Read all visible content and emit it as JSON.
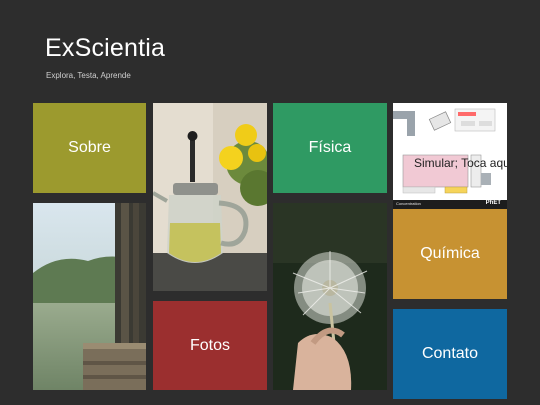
{
  "header": {
    "title": "ExScientia",
    "subtitle": "Explora, Testa, Aprende"
  },
  "tiles": {
    "sobre": {
      "label": "Sobre",
      "color": "#9c9a2e"
    },
    "fisica": {
      "label": "Física",
      "color": "#2f9a63"
    },
    "fotos": {
      "label": "Fotos",
      "color": "#9b2f2f"
    },
    "quimica": {
      "label": "Química",
      "color": "#c79232"
    },
    "contato": {
      "label": "Contato",
      "color": "#0f68a0"
    },
    "simular": {
      "label": "Simular; Toca aqui",
      "footer_left": "Concentration",
      "footer_right": "PhET"
    }
  },
  "images": {
    "teapot": "teapot-with-flowers-photo",
    "lake": "lake-dock-photo",
    "dandelion": "dandelion-hand-photo"
  }
}
